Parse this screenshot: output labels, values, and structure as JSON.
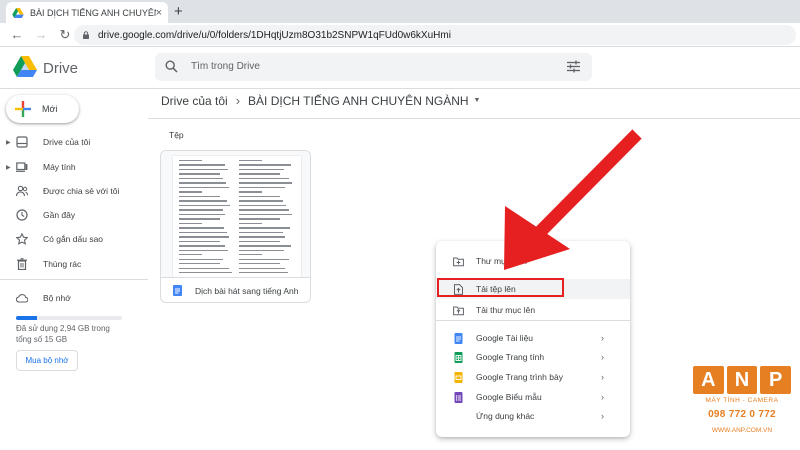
{
  "browser": {
    "tab_title": "BÀI DỊCH TIẾNG ANH CHUYÊN N",
    "new_tab": "+",
    "url": "drive.google.com/drive/u/0/folders/1DHqtjUzm8O31b2SNPW1qFUd0w6kXuHmi"
  },
  "header": {
    "brand": "Drive",
    "search_placeholder": "Tìm trong Drive"
  },
  "sidebar": {
    "new_button": "Mới",
    "items": [
      {
        "label": "Drive của tôi",
        "icon": "my-drive-icon"
      },
      {
        "label": "Máy tính",
        "icon": "computer-icon"
      },
      {
        "label": "Được chia sẻ với tôi",
        "icon": "shared-icon"
      },
      {
        "label": "Gần đây",
        "icon": "clock-icon"
      },
      {
        "label": "Có gắn dấu sao",
        "icon": "star-icon"
      },
      {
        "label": "Thùng rác",
        "icon": "trash-icon"
      },
      {
        "label": "Bộ nhớ",
        "icon": "cloud-icon"
      }
    ],
    "storage_text": "Đã sử dụng 2,94 GB trong tổng số 15 GB",
    "storage_fraction": 0.196,
    "buy_storage": "Mua bộ nhớ"
  },
  "breadcrumb": {
    "root": "Drive của tôi",
    "separator": "›",
    "current": "BÀI DỊCH TIẾNG ANH CHUYÊN NGÀNH"
  },
  "files": {
    "section_label": "Tệp",
    "items": [
      {
        "name": "Dịch bài hát sang tiếng Anh"
      }
    ]
  },
  "context_menu": {
    "items": [
      {
        "label": "Thư mục mới",
        "icon": "new-folder-icon"
      },
      {
        "label": "Tải tệp lên",
        "icon": "file-upload-icon"
      },
      {
        "label": "Tải thư mục lên",
        "icon": "folder-upload-icon"
      },
      {
        "label": "Google Tài liệu",
        "icon": "google-docs-icon"
      },
      {
        "label": "Google Trang tính",
        "icon": "google-sheets-icon"
      },
      {
        "label": "Google Trang trình bày",
        "icon": "google-slides-icon"
      },
      {
        "label": "Google Biểu mẫu",
        "icon": "google-forms-icon"
      },
      {
        "label": "Ứng dụng khác",
        "icon": "more-apps-icon"
      }
    ],
    "chevron": "›"
  },
  "watermark": {
    "letters": [
      "A",
      "N",
      "P"
    ],
    "tagline": "MÁY TÍNH - CAMERA",
    "phone": "098 772 0 772",
    "site": "WWW.ANP.COM.VN"
  },
  "colors": {
    "accent": "#1a73e8",
    "highlight": "#e62020",
    "watermark": "#e67e22",
    "docs": "#4285f4",
    "sheets": "#0f9d58",
    "slides": "#f4b400",
    "forms": "#7248b9"
  }
}
